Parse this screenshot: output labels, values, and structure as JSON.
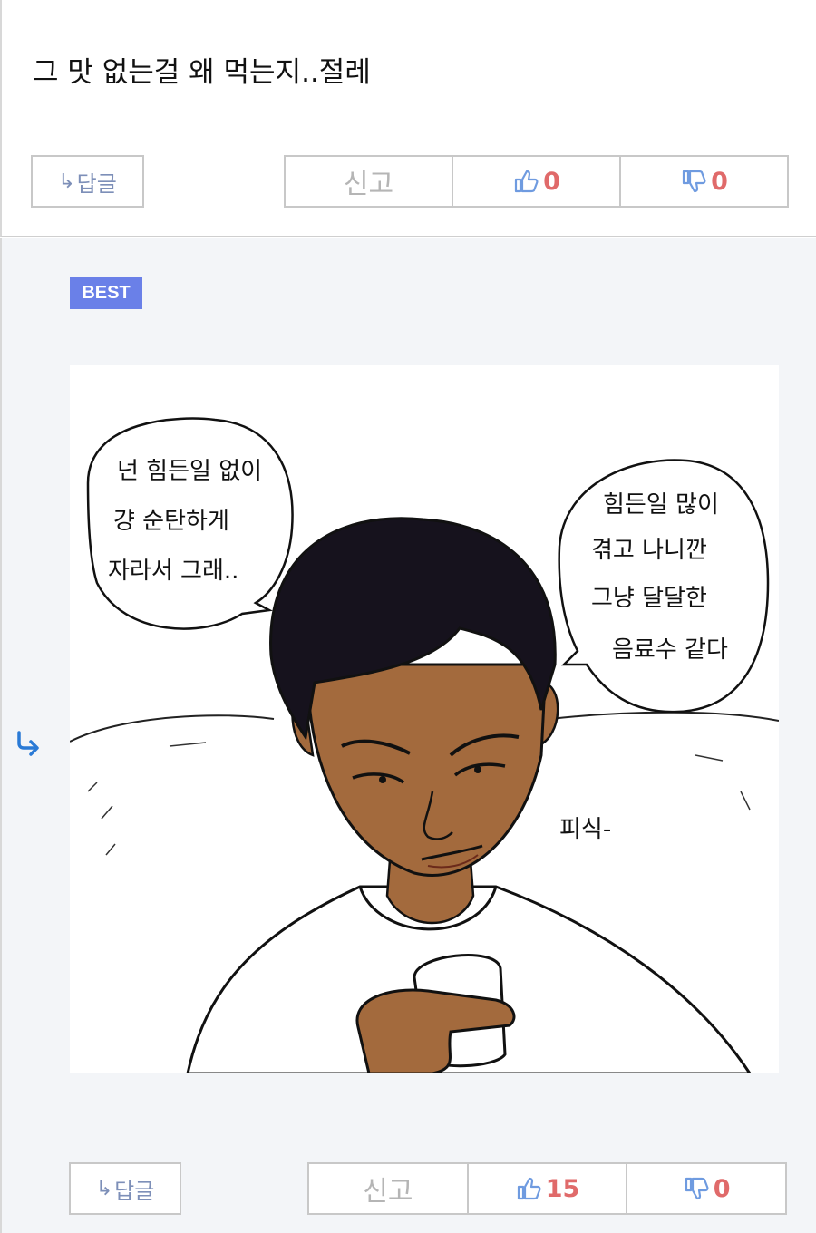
{
  "comment1": {
    "text": "그 맛 없는걸 왜 먹는지..절레",
    "reply_label": "답글",
    "report_label": "신고",
    "likes": "0",
    "dislikes": "0"
  },
  "comment2": {
    "badge": "BEST",
    "reply_label": "답글",
    "report_label": "신고",
    "likes": "15",
    "dislikes": "0",
    "comic": {
      "left_bubble": [
        "넌 힘든일 없이",
        "걍 순탄하게",
        "자라서 그래.."
      ],
      "right_bubble": [
        "힘든일 많이",
        "겪고 나니깐",
        "그냥 달달한",
        "음료수 같다"
      ],
      "sfx": "피식-"
    }
  },
  "colors": {
    "accent": "#6a80e8",
    "reply_text": "#7d8fb8",
    "vote_count": "#e06a6a",
    "thumb_icon": "#6f9be0",
    "reply_arrow": "#2a7ad6"
  },
  "icons": [
    "reply-arrow-icon",
    "thumbs-up-icon",
    "thumbs-down-icon"
  ]
}
